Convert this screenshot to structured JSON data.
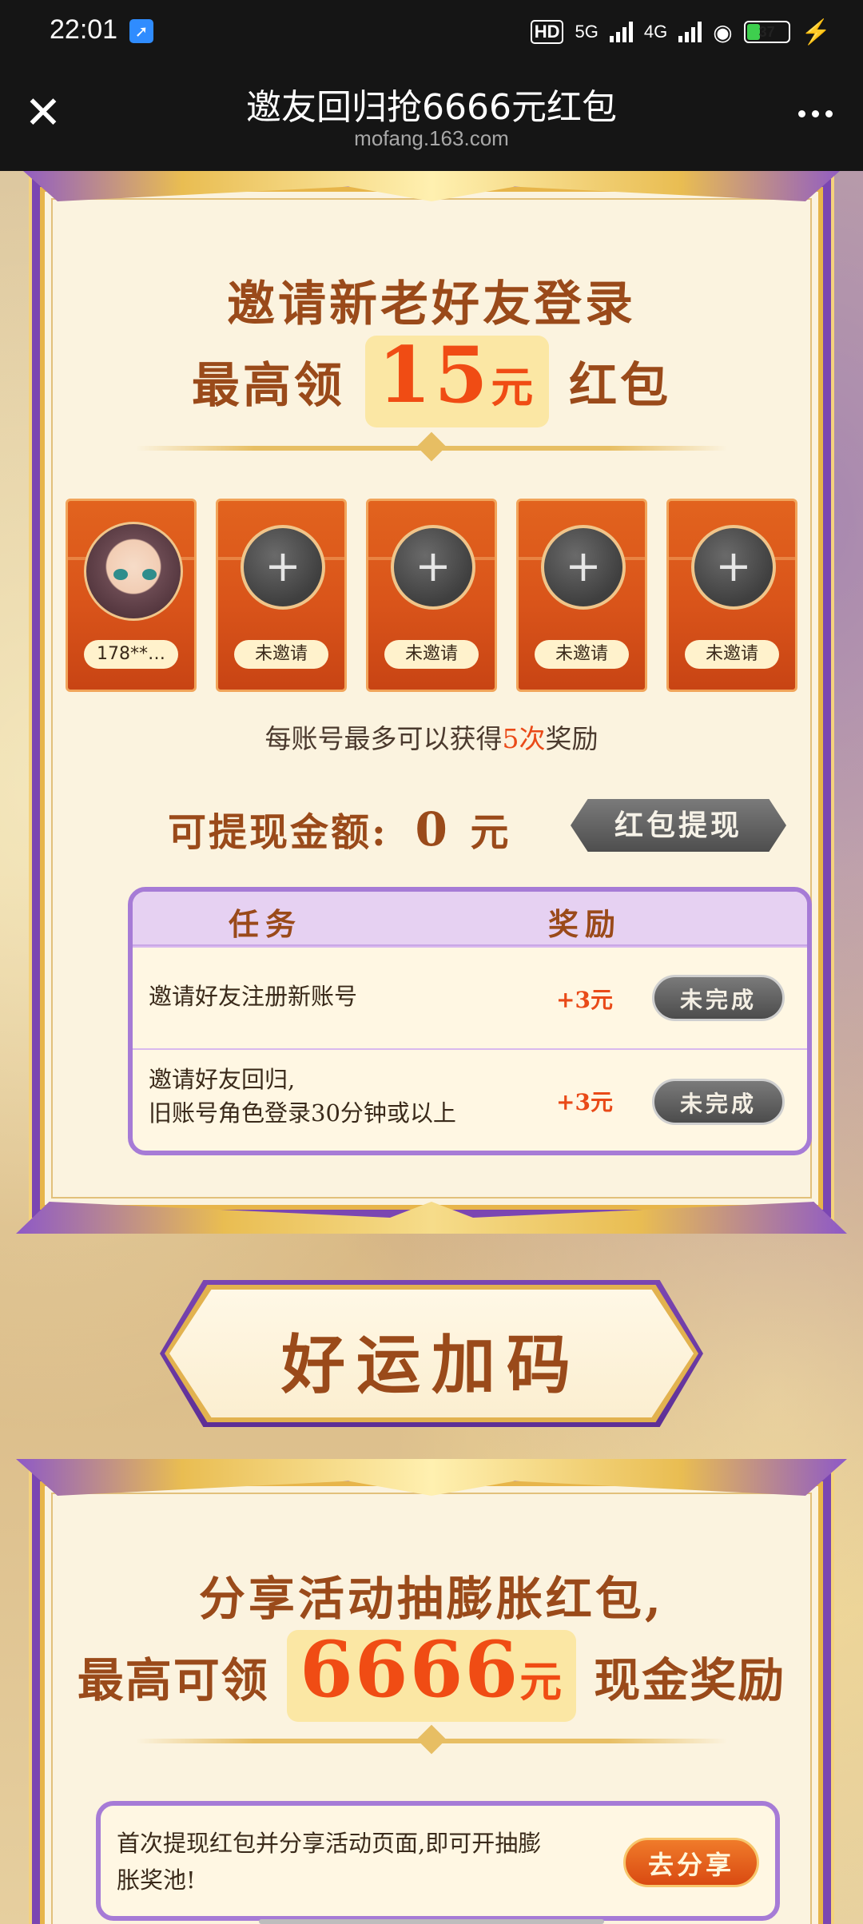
{
  "status": {
    "time": "22:01",
    "network_hd": "HD",
    "net1": "5G",
    "net2": "4G",
    "battery": "37",
    "battery_fraction": 0.37
  },
  "titlebar": {
    "title": "邀友回归抢6666元红包",
    "url": "mofang.163.com",
    "close_icon": "close-icon",
    "more_icon": "more-icon"
  },
  "invite": {
    "heading_line1": "邀请新老好友登录",
    "heading_pre": "最高领",
    "heading_amount": "15",
    "heading_unit": "元",
    "heading_post": "红包",
    "cards": [
      {
        "label": "178**…",
        "filled": true
      },
      {
        "label": "未邀请",
        "filled": false
      },
      {
        "label": "未邀请",
        "filled": false
      },
      {
        "label": "未邀请",
        "filled": false
      },
      {
        "label": "未邀请",
        "filled": false
      }
    ],
    "limit_pre": "每账号最多可以获得",
    "limit_hl": "5次",
    "limit_post": "奖励",
    "withdraw_label": "可提现金额:",
    "withdraw_amount": "0",
    "withdraw_unit": "元",
    "withdraw_button": "红包提现"
  },
  "tasks": {
    "col_task": "任务",
    "col_reward": "奖励",
    "rows": [
      {
        "text": "邀请好友注册新账号",
        "reward": "+3元",
        "status": "未完成"
      },
      {
        "text_line1": "邀请好友回归,",
        "text_line2": "旧账号角色登录30分钟或以上",
        "reward": "+3元",
        "status": "未完成"
      }
    ]
  },
  "luck": {
    "banner": "好运加码",
    "heading_line1": "分享活动抽膨胀红包,",
    "heading_pre": "最高可领",
    "heading_amount": "6666",
    "heading_unit": "元",
    "heading_post": "现金奖励",
    "share_text": "首次提现红包并分享活动页面,即可开抽膨胀奖池!",
    "share_button": "去分享"
  },
  "colors": {
    "accent_orange": "#f04c14",
    "frame_purple": "#7b46b2",
    "heading_brown": "#9a4a1a"
  }
}
